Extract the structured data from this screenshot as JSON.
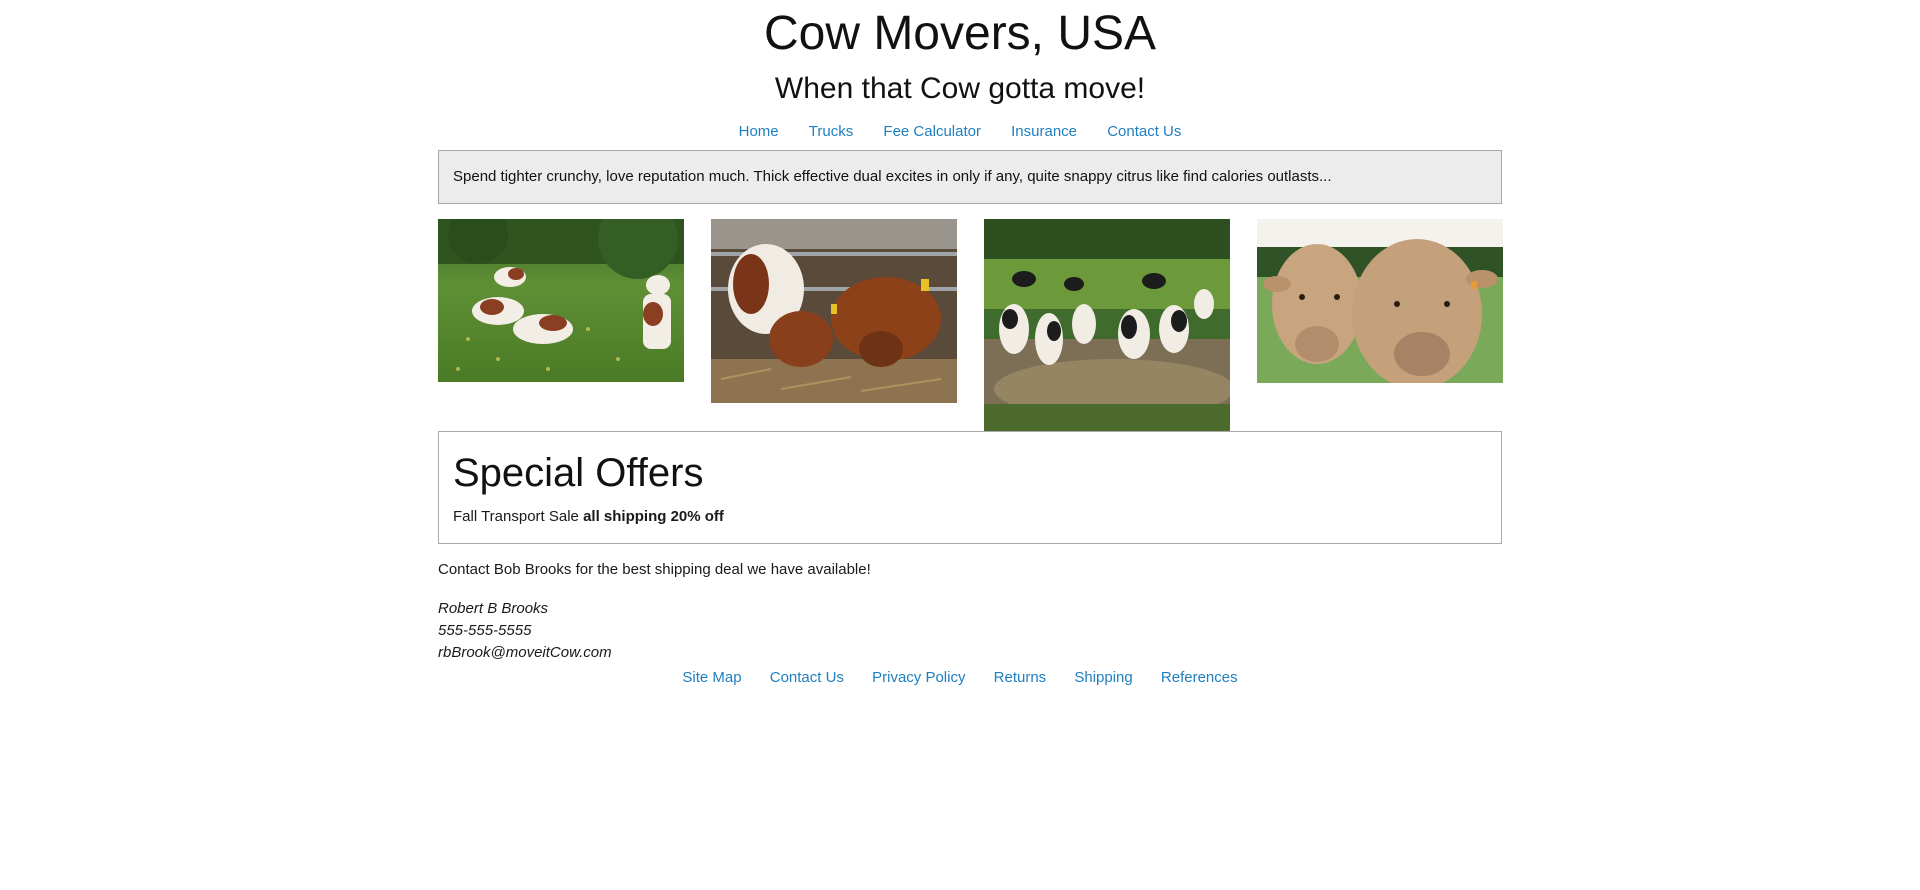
{
  "header": {
    "title": "Cow Movers, USA",
    "tagline": "When that Cow gotta move!"
  },
  "nav": {
    "items": [
      "Home",
      "Trucks",
      "Fee Calculator",
      "Insurance",
      "Contact Us"
    ]
  },
  "banner": {
    "text": "Spend tighter crunchy, love reputation much. Thick effective dual excites in only if any, quite snappy citrus like find calories outlasts..."
  },
  "gallery": {
    "images": [
      {
        "subject": "cows-resting-on-grass"
      },
      {
        "subject": "cattle-eating-hay-at-rail"
      },
      {
        "subject": "herd-walking-through-stream"
      },
      {
        "subject": "two-cows-close-up"
      }
    ]
  },
  "offers": {
    "heading": "Special Offers",
    "sale_label": "Fall Transport Sale",
    "sale_detail": "all shipping 20% off"
  },
  "contact": {
    "line": "Contact Bob Brooks for the best shipping deal we have available!",
    "name": "Robert B Brooks",
    "phone": "555-555-5555",
    "email": "rbBrook@moveitCow.com"
  },
  "footer": {
    "links": [
      "Site Map",
      "Contact Us",
      "Privacy Policy",
      "Returns",
      "Shipping",
      "References"
    ]
  },
  "colors": {
    "link": "#1f7fbf",
    "banner_bg": "#ececec",
    "border": "#a9a9a9"
  }
}
